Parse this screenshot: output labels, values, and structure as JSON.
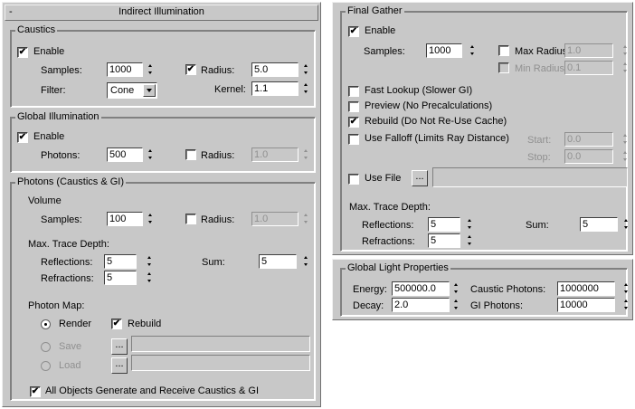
{
  "left": {
    "rollout_title": "Indirect Illumination",
    "rollout_toggle": "-",
    "caustics": {
      "title": "Caustics",
      "enable_label": "Enable",
      "samples_label": "Samples:",
      "samples_value": "1000",
      "radius_label": "Radius:",
      "radius_value": "5.0",
      "filter_label": "Filter:",
      "filter_value": "Cone",
      "kernel_label": "Kernel:",
      "kernel_value": "1.1"
    },
    "gi": {
      "title": "Global Illumination",
      "enable_label": "Enable",
      "photons_label": "Photons:",
      "photons_value": "500",
      "radius_label": "Radius:",
      "radius_value": "1.0"
    },
    "photons": {
      "title": "Photons (Caustics & GI)",
      "volume_label": "Volume",
      "samples_label": "Samples:",
      "samples_value": "100",
      "radius_label": "Radius:",
      "radius_value": "1.0",
      "max_trace_label": "Max. Trace Depth:",
      "reflections_label": "Reflections:",
      "reflections_value": "5",
      "refractions_label": "Refractions:",
      "refractions_value": "5",
      "sum_label": "Sum:",
      "sum_value": "5",
      "photon_map_label": "Photon Map:",
      "render_label": "Render",
      "rebuild_label": "Rebuild",
      "save_label": "Save",
      "load_label": "Load",
      "browse_label": "...",
      "all_objects_label": "All Objects Generate and Receive Caustics & GI"
    }
  },
  "right": {
    "final_gather": {
      "title": "Final Gather",
      "enable_label": "Enable",
      "samples_label": "Samples:",
      "samples_value": "1000",
      "max_radius_label": "Max Radius:",
      "max_radius_value": "1.0",
      "min_radius_label": "Min Radius:",
      "min_radius_value": "0.1",
      "fast_lookup_label": "Fast Lookup (Slower GI)",
      "preview_label": "Preview (No Precalculations)",
      "rebuild_label": "Rebuild (Do Not Re-Use Cache)",
      "use_falloff_label": "Use Falloff (Limits Ray Distance)",
      "start_label": "Start:",
      "start_value": "0.0",
      "stop_label": "Stop:",
      "stop_value": "0.0",
      "use_file_label": "Use File",
      "browse_label": "...",
      "max_trace_label": "Max. Trace Depth:",
      "reflections_label": "Reflections:",
      "reflections_value": "5",
      "refractions_label": "Refractions:",
      "refractions_value": "5",
      "sum_label": "Sum:",
      "sum_value": "5"
    },
    "global_light": {
      "title": "Global Light Properties",
      "energy_label": "Energy:",
      "energy_value": "500000.0",
      "decay_label": "Decay:",
      "decay_value": "2.0",
      "caustic_photons_label": "Caustic Photons:",
      "caustic_photons_value": "1000000",
      "gi_photons_label": "GI Photons:",
      "gi_photons_value": "10000"
    }
  }
}
